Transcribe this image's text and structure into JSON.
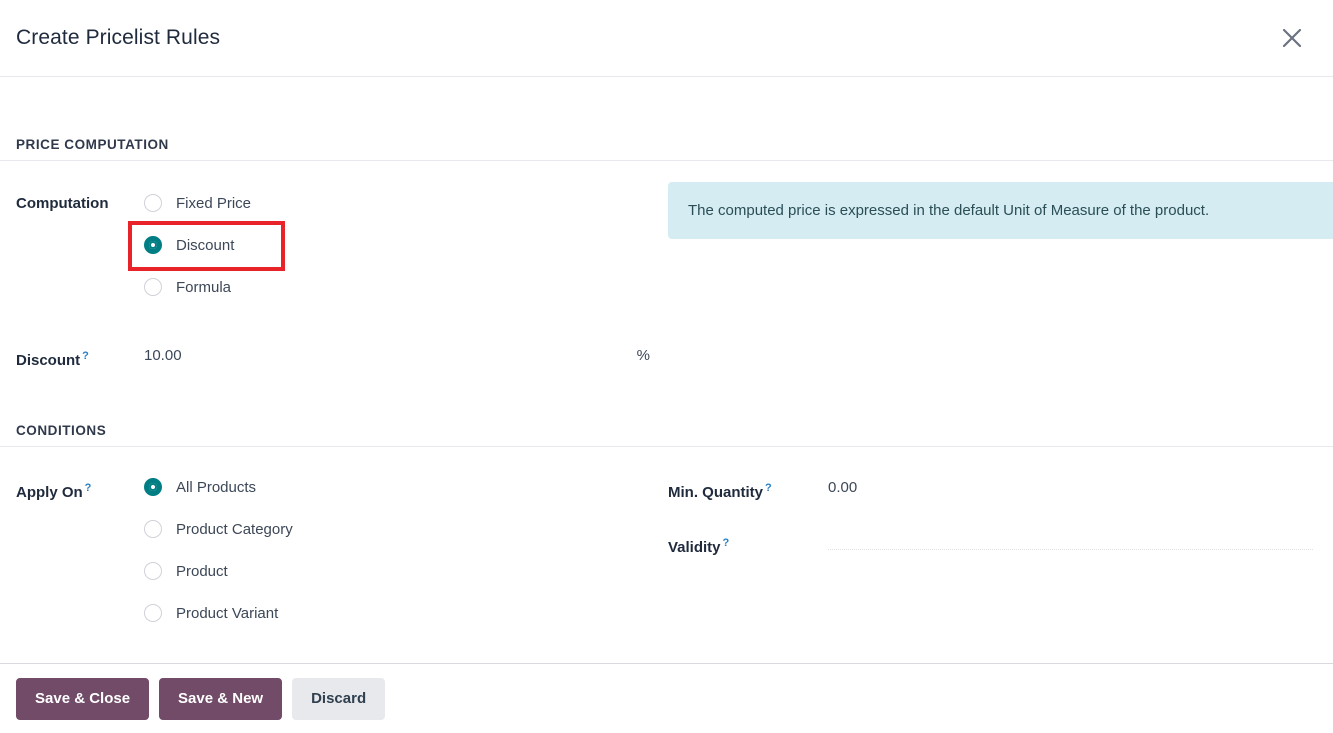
{
  "dialog": {
    "title": "Create Pricelist Rules",
    "close_icon": "close-icon"
  },
  "sections": {
    "price_computation": {
      "title": "PRICE COMPUTATION",
      "computation": {
        "label": "Computation",
        "options": [
          {
            "label": "Fixed Price",
            "selected": false
          },
          {
            "label": "Discount",
            "selected": true
          },
          {
            "label": "Formula",
            "selected": false
          }
        ],
        "selected_value": "Discount"
      },
      "alert": {
        "text": "The computed price is expressed in the default Unit of Measure of the product.",
        "bg_color": "#d4ecf2"
      },
      "discount": {
        "label": "Discount",
        "tooltip_marker": "?",
        "value": "10.00",
        "suffix": "%"
      }
    },
    "conditions": {
      "title": "CONDITIONS",
      "apply_on": {
        "label": "Apply On",
        "tooltip_marker": "?",
        "options": [
          {
            "label": "All Products",
            "selected": true
          },
          {
            "label": "Product Category",
            "selected": false
          },
          {
            "label": "Product",
            "selected": false
          },
          {
            "label": "Product Variant",
            "selected": false
          }
        ],
        "selected_value": "All Products"
      },
      "min_quantity": {
        "label": "Min. Quantity",
        "tooltip_marker": "?",
        "value": "0.00"
      },
      "validity": {
        "label": "Validity",
        "tooltip_marker": "?",
        "value": "",
        "placeholder": ""
      }
    }
  },
  "footer": {
    "save_close_label": "Save & Close",
    "save_new_label": "Save & New",
    "discard_label": "Discard"
  },
  "highlight": {
    "target": "Discount",
    "color": "#e8242a"
  }
}
